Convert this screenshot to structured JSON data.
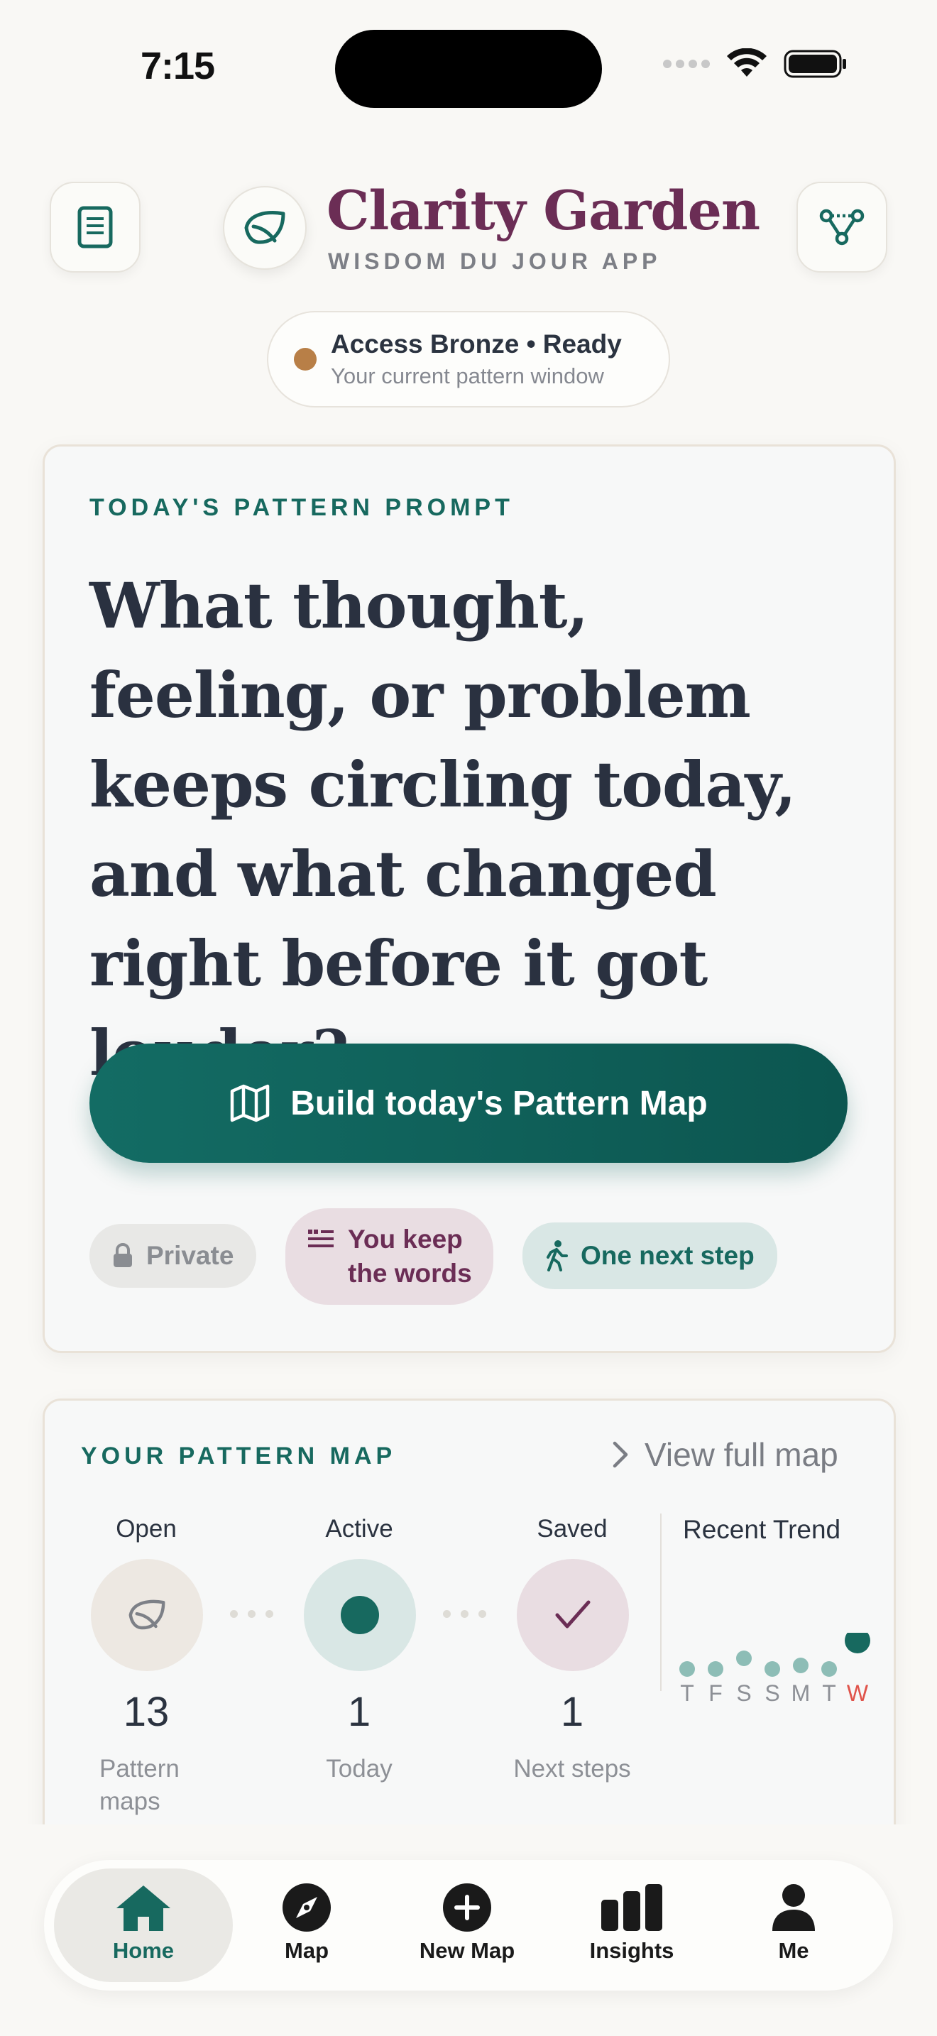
{
  "status_bar": {
    "time": "7:15"
  },
  "header": {
    "app_name": "Clarity Garden",
    "app_subtitle": "WISDOM DU JOUR APP",
    "access_title": "Access Bronze • Ready",
    "access_subtitle": "Your current pattern window"
  },
  "prompt_card": {
    "eyebrow": "TODAY'S PATTERN PROMPT",
    "question": "What thought, feeling, or problem keeps circling today, and what changed right before it got louder?",
    "cta_label": "Build today's Pattern Map",
    "chips": {
      "private": "Private",
      "words_line1": "You keep",
      "words_line2": "the words",
      "next_step": "One next step"
    }
  },
  "pattern_map": {
    "eyebrow": "YOUR PATTERN MAP",
    "view_full_map": "View full map",
    "stats": [
      {
        "label": "Open",
        "value": "13",
        "caption_line1": "Pattern",
        "caption_line2": "maps"
      },
      {
        "label": "Active",
        "value": "1",
        "caption_line1": "Today",
        "caption_line2": ""
      },
      {
        "label": "Saved",
        "value": "1",
        "caption_line1": "Next steps",
        "caption_line2": ""
      }
    ],
    "trend": {
      "title": "Recent Trend",
      "days": [
        "T",
        "F",
        "S",
        "S",
        "M",
        "T",
        "W"
      ],
      "current_day_index": 6,
      "levels": [
        0.15,
        0.15,
        0.3,
        0.15,
        0.2,
        0.15,
        0.55
      ]
    }
  },
  "bottom_nav": {
    "items": [
      {
        "label": "Home",
        "icon": "home-icon",
        "active": true
      },
      {
        "label": "Map",
        "icon": "compass-icon",
        "active": false
      },
      {
        "label": "New Map",
        "icon": "plus-circle-icon",
        "active": false
      },
      {
        "label": "Insights",
        "icon": "bar-chart-icon",
        "active": false
      },
      {
        "label": "Me",
        "icon": "person-icon",
        "active": false
      }
    ]
  },
  "colors": {
    "brand_plum": "#6b2d55",
    "brand_teal": "#17695f",
    "bronze": "#b87f47",
    "background": "#f9f8f5",
    "accent_red": "#e0534a"
  }
}
